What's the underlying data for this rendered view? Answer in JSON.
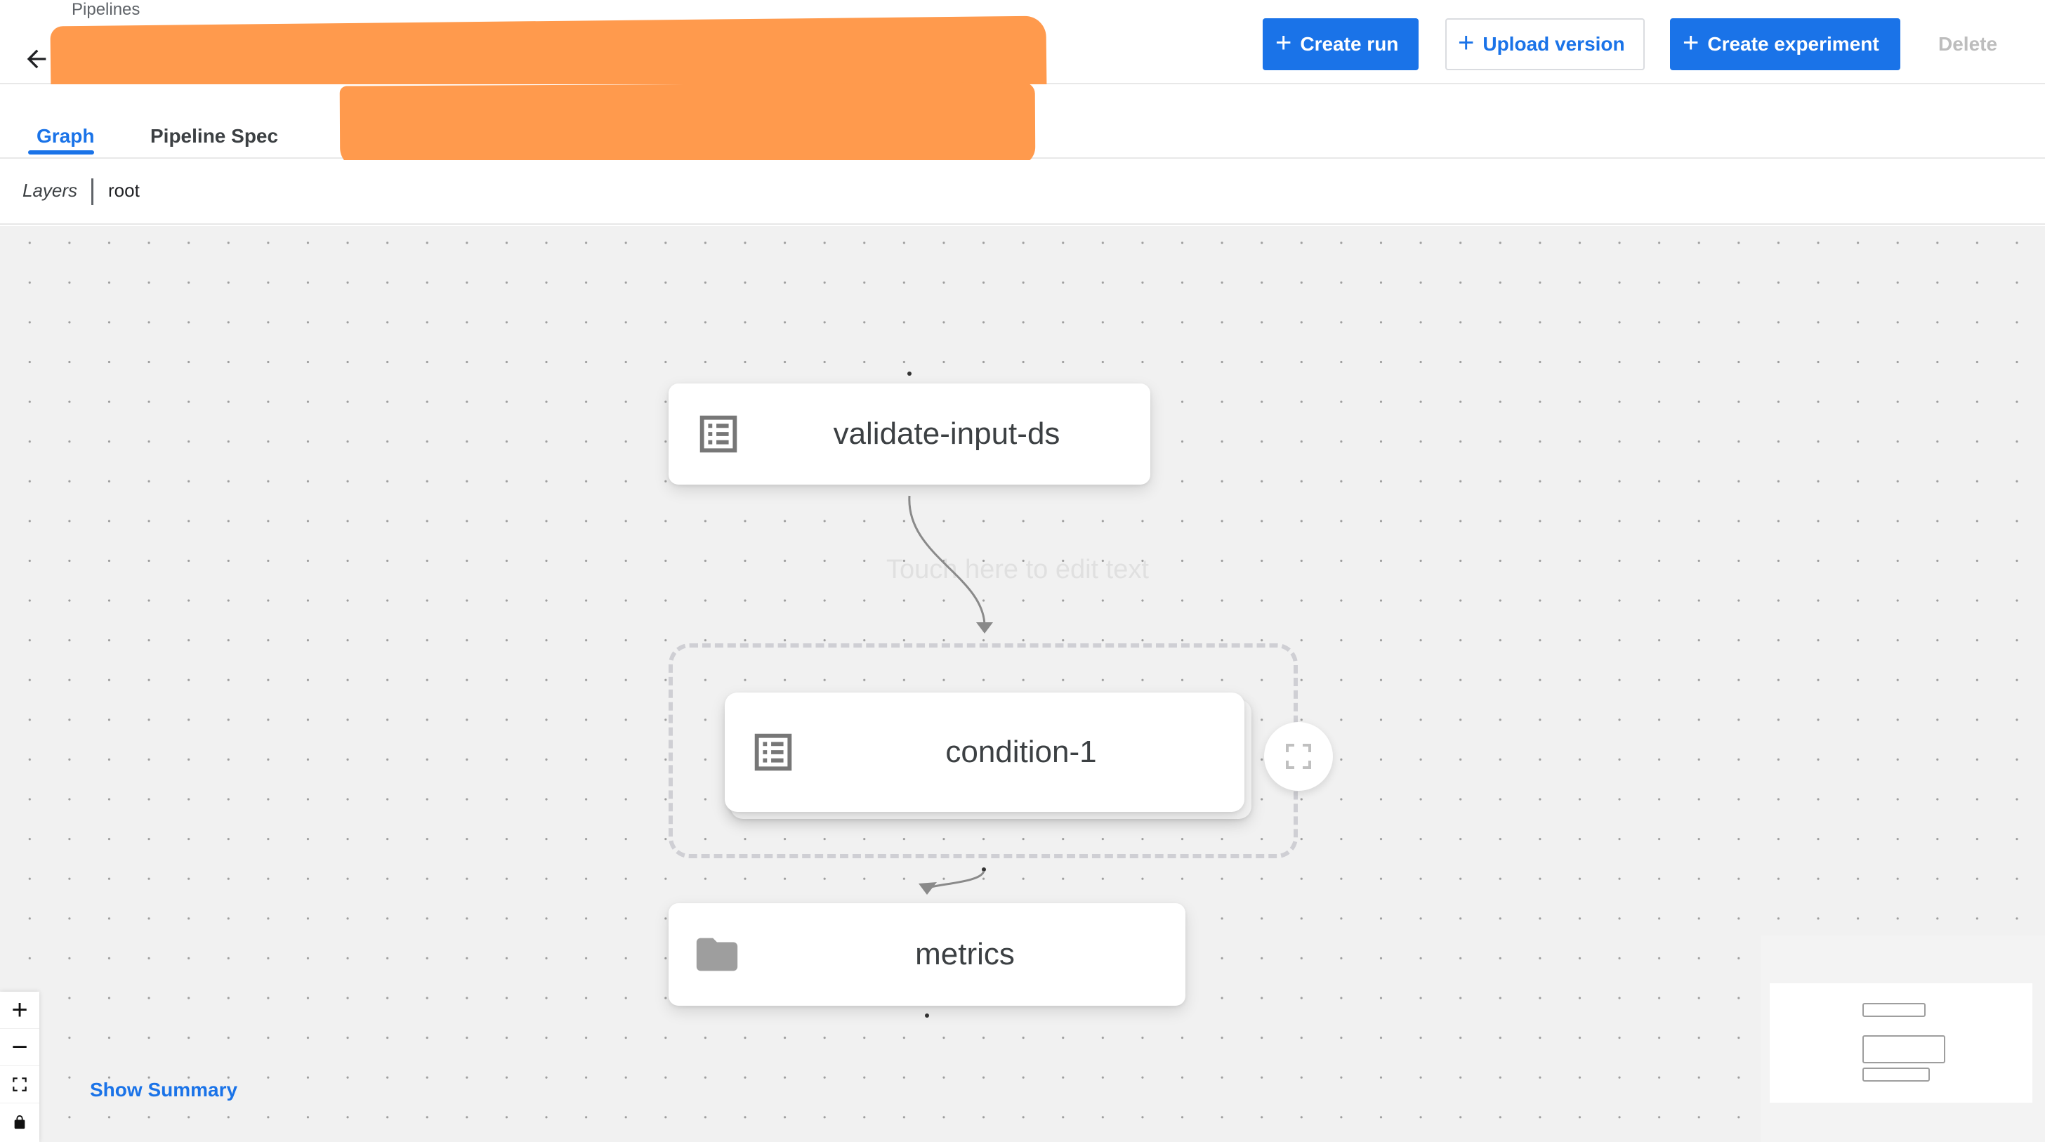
{
  "header": {
    "breadcrumb": "Pipelines",
    "buttons": {
      "create_run": "Create run",
      "upload_version": "Upload version",
      "create_experiment": "Create experiment",
      "delete": "Delete"
    }
  },
  "tabs": [
    {
      "label": "Graph",
      "active": true
    },
    {
      "label": "Pipeline Spec",
      "active": false
    }
  ],
  "layers": {
    "label": "Layers",
    "current": "root"
  },
  "graph": {
    "ghost_text": "Touch here to edit text",
    "nodes": [
      {
        "label": "validate-input-ds",
        "icon": "list-icon"
      },
      {
        "label": "condition-1",
        "icon": "list-icon"
      },
      {
        "label": "metrics",
        "icon": "folder-icon"
      }
    ]
  },
  "controls": {
    "zoom_in": "+",
    "zoom_out": "−"
  },
  "show_summary": "Show Summary",
  "colors": {
    "accent": "#1a73e8",
    "redaction": "#ff9a4d",
    "canvas": "#f1f1f1"
  }
}
